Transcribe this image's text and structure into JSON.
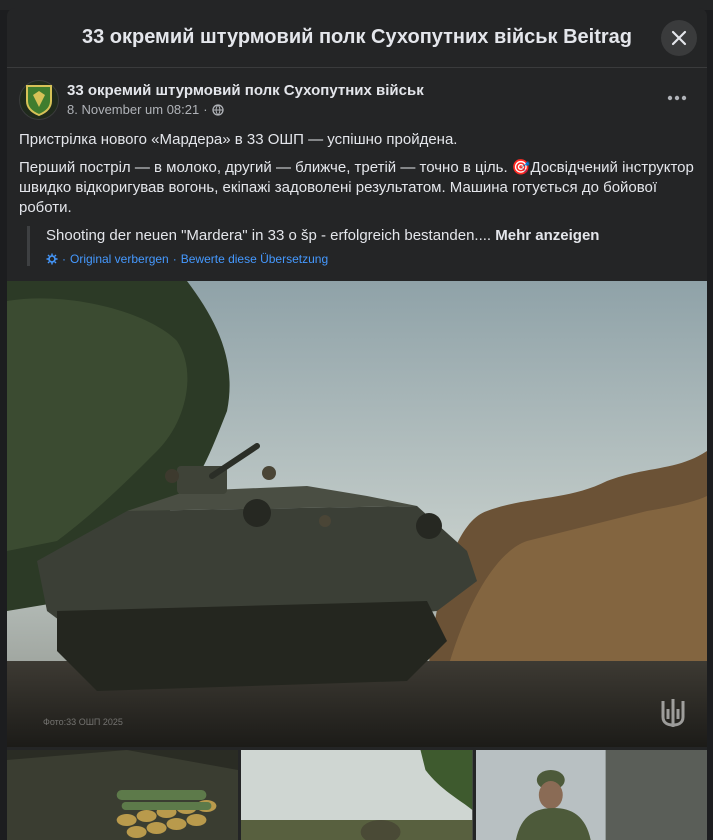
{
  "modal": {
    "title": "33 окремий штурмовий полк Сухопутних військ Beitrag"
  },
  "post": {
    "author": "33 окремий штурмовий полк Сухопутних військ",
    "timestamp": "8. November um 08:21",
    "privacy_sep": "·",
    "paragraph1": "Пристрілка нового «Мардера» в 33 ОШП — успішно пройдена.",
    "paragraph2": "Перший постріл — в молоко, другий — ближче, третій — точно в ціль. 🎯Досвідчений інструктор швидко відкоригував вогонь, екіпажі задоволені результатом. Машина готується до бойової роботи.",
    "translation_text": "Shooting der neuen \"Mardera\" in 33 o šp - erfolgreich bestanden.... ",
    "see_more": "Mehr anzeigen",
    "hide_original": "Original verbergen",
    "dot": "·",
    "rate_translation": "Bewerte diese Übersetzung"
  },
  "photos": {
    "watermark": "Фото:33 ОШП 2025"
  },
  "icons": {
    "close": "close-icon",
    "more": "more-icon",
    "globe": "globe-icon",
    "translate": "translate-icon",
    "trident": "trident-icon"
  }
}
